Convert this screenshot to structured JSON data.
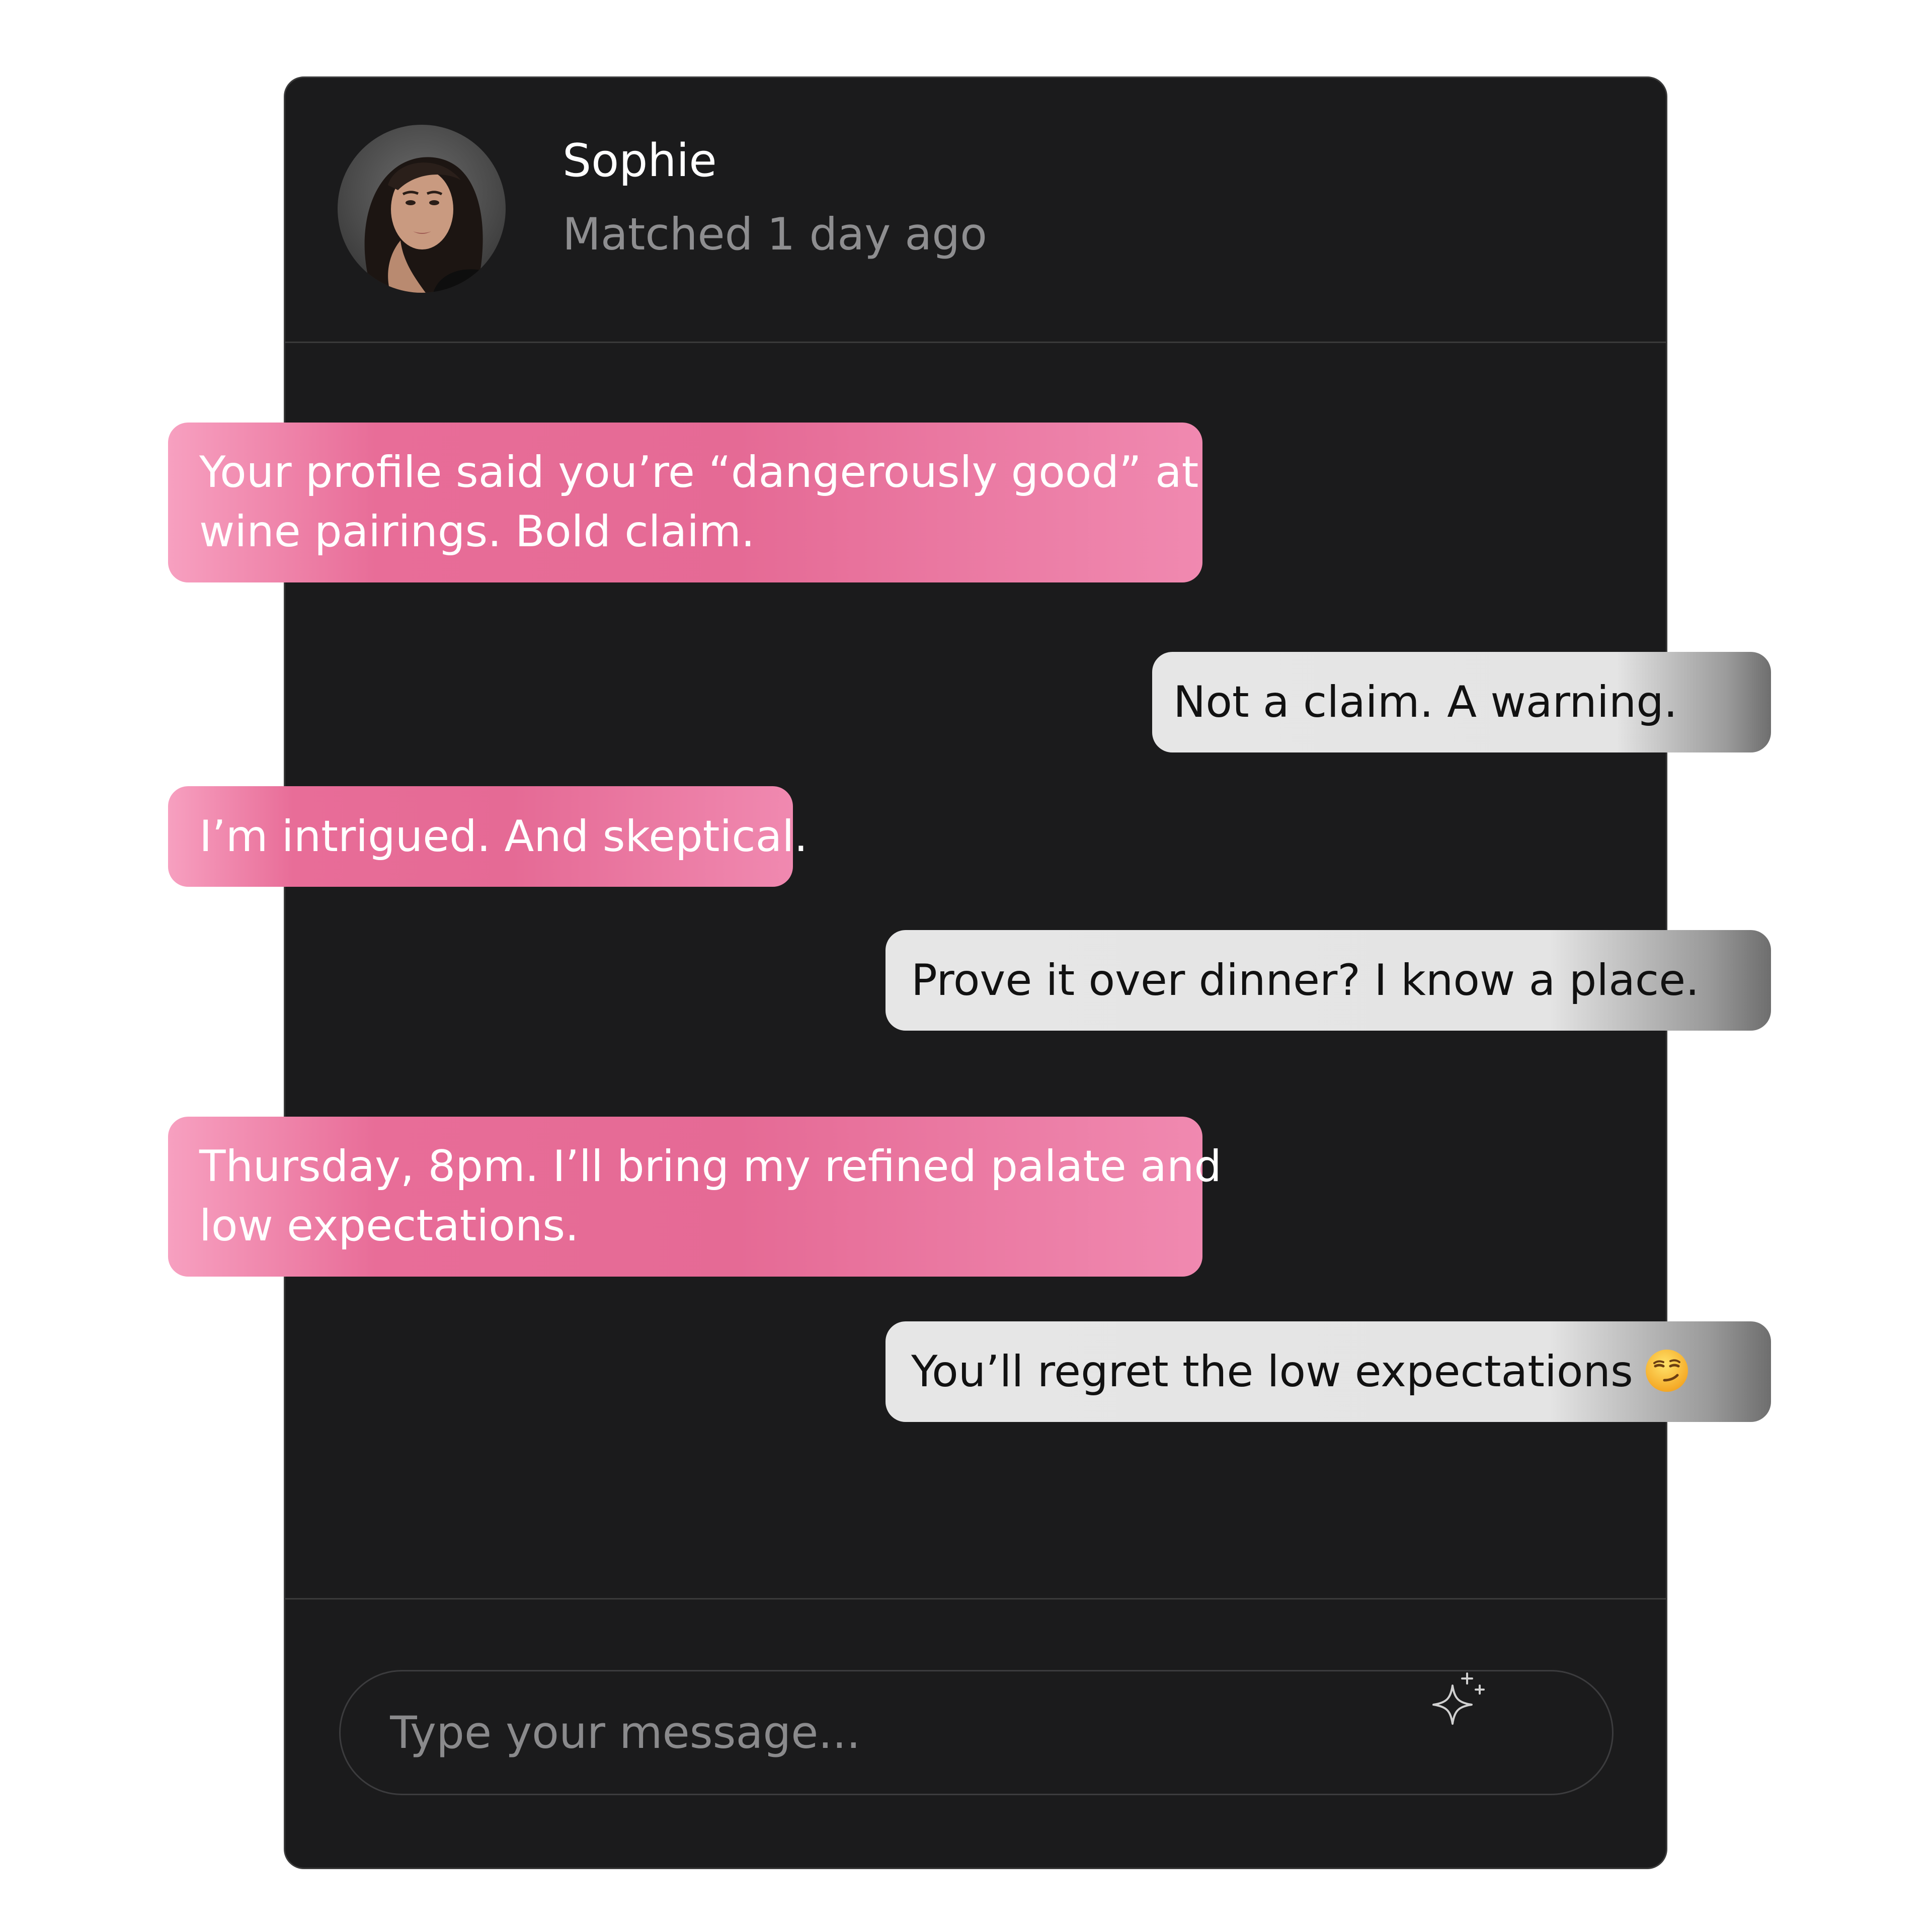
{
  "header": {
    "contact_name": "Sophie",
    "match_status": "Matched 1 day ago"
  },
  "messages": [
    {
      "direction": "received",
      "lines": [
        "Your profile said you’re “dangerously good” at",
        "wine pairings. Bold claim."
      ]
    },
    {
      "direction": "sent",
      "lines": [
        "Not a claim. A warning."
      ]
    },
    {
      "direction": "received",
      "lines": [
        "I’m intrigued. And skeptical."
      ]
    },
    {
      "direction": "sent",
      "lines": [
        "Prove it over dinner? I know a place."
      ]
    },
    {
      "direction": "received",
      "lines": [
        "Thursday, 8pm. I’ll bring my refined palate and",
        "low expectations."
      ]
    },
    {
      "direction": "sent",
      "lines": [
        "You’ll regret the low expectations"
      ],
      "emoji": "smirking-face-icon"
    }
  ],
  "composer": {
    "placeholder": "Type your message...",
    "value": "",
    "ai_button_icon": "sparkle-icon"
  },
  "colors": {
    "window_background": "#1b1b1c",
    "received_bubble": "#e86d98",
    "sent_bubble": "#e4e4e4"
  }
}
